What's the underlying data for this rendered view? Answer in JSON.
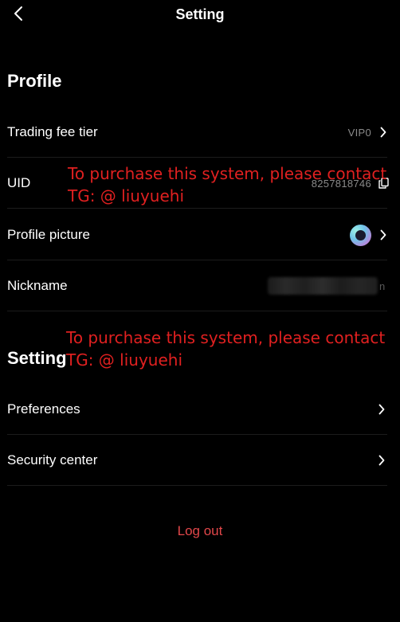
{
  "header": {
    "title": "Setting",
    "back_icon": "chevron-left-icon"
  },
  "profile_section": {
    "heading": "Profile",
    "rows": [
      {
        "label": "Trading fee tier",
        "value": "VIP0"
      },
      {
        "label": "UID",
        "value": "8257818746"
      },
      {
        "label": "Profile picture"
      },
      {
        "label": "Nickname",
        "value_tail": "n"
      }
    ]
  },
  "setting_section": {
    "heading": "Setting",
    "rows": [
      {
        "label": "Preferences"
      },
      {
        "label": "Security center"
      }
    ]
  },
  "watermark": {
    "line1": "To purchase this system, please contact",
    "line2": "TG: @ liuyuehi"
  },
  "logout": {
    "label": "Log out"
  },
  "colors": {
    "background": "#000000",
    "text": "#ffffff",
    "muted": "#8a8a8a",
    "logout": "#e2474a",
    "watermark": "#e02020"
  }
}
